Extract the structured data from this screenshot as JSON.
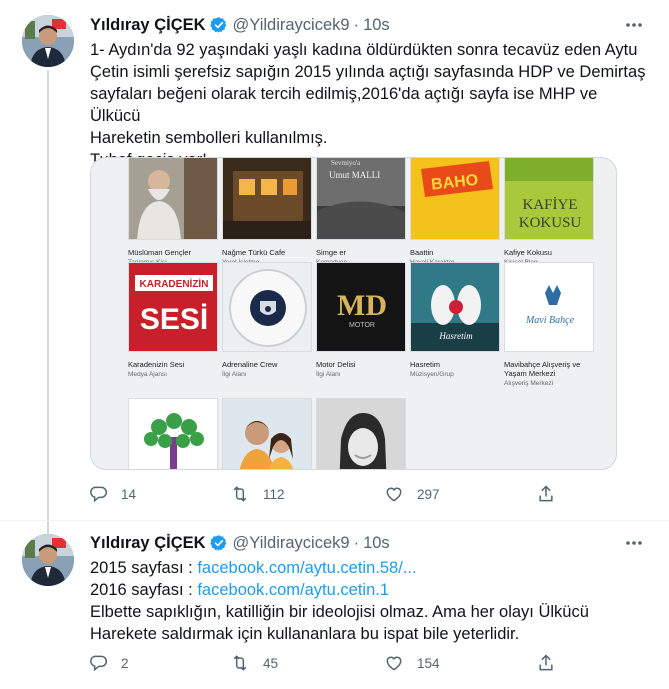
{
  "tweets": [
    {
      "display_name": "Yıldıray ÇİÇEK",
      "handle": "@Yildiraycicek9",
      "separator": "·",
      "time": "10s",
      "text_lines": [
        "1- Aydın'da 92 yaşındaki yaşlı kadına öldürdükten sonra tecavüz eden Aytu",
        "Çetin isimli şerefsiz sapığın 2015 yılında açtığı sayfasında HDP ve Demirtaş",
        "sayfaları beğeni olarak tercih edilmiş,2016'da açtığı sayfa ise MHP ve Ülkücü",
        "Hareketin sembolleri kullanılmış.",
        "Tuhaf geçiş var!"
      ],
      "replies": "14",
      "retweets": "112",
      "likes": "297",
      "media": {
        "cards": [
          {
            "name": "Müslüman Gençler",
            "category": "Tanınmış Kişi"
          },
          {
            "name": "Nağme Türkü Cafe",
            "category": "Yerel İşletme"
          },
          {
            "name": "Simge er",
            "category": "Komedyen"
          },
          {
            "name": "Baattin",
            "category": "Hayali Karakter"
          },
          {
            "name": "Kafiye Kokusu",
            "category": "Kişisel Blog"
          },
          {
            "name": "Karadenizin Sesi",
            "category": "Medya Ajansı"
          },
          {
            "name": "Adrenaline Crew",
            "category": "İlgi Alanı"
          },
          {
            "name": "Motor Delisi",
            "category": "İlgi Alanı"
          },
          {
            "name": "Hasretim",
            "category": "Müzisyen/Grup"
          },
          {
            "name": "Mavibahçe Alışveriş ve Yaşam Merkezi",
            "category": "Alışveriş Merkezi"
          },
          {
            "name": "",
            "category": ""
          },
          {
            "name": "",
            "category": ""
          },
          {
            "name": "",
            "category": ""
          }
        ],
        "thumb_texts": {
          "simge_top": "Sevmiyo'a",
          "simge_mid": "Umut MALLI",
          "baho": "BAHO",
          "kafiye_1": "KAFİYE",
          "kafiye_2": "KOKUSU",
          "karadeniz_1": "KARADENİZİN",
          "karadeniz_2": "SESİ",
          "md": "MD",
          "md_sub": "MOTOR",
          "hasretim": "Hasretim",
          "mavi": "Mavi Bahçe"
        }
      }
    },
    {
      "display_name": "Yıldıray ÇİÇEK",
      "handle": "@Yildiraycicek9",
      "separator": "·",
      "time": "10s",
      "line1_prefix": "2015 sayfası : ",
      "line1_link": "facebook.com/aytu.cetin.58/...",
      "line2_prefix": "2016 sayfası : ",
      "line2_link": "facebook.com/aytu.cetin.1",
      "text_lines": [
        "Elbette sapıklığın, katilliğin bir ideolojisi olmaz. Ama her olayı Ülkücü",
        "Harekete saldırmak için kullananlara bu ispat bile yeterlidir."
      ],
      "replies": "2",
      "retweets": "45",
      "likes": "154"
    }
  ],
  "icons": {
    "verified": "verified-badge-icon",
    "more": "more-dots-icon",
    "reply": "reply-icon",
    "retweet": "retweet-icon",
    "like": "heart-icon",
    "share": "share-icon"
  },
  "colors": {
    "link": "#1d9bf0",
    "secondary_text": "#536471",
    "primary_text": "#0f1419",
    "verified": "#1d9bf0",
    "border": "#cfd9de"
  }
}
